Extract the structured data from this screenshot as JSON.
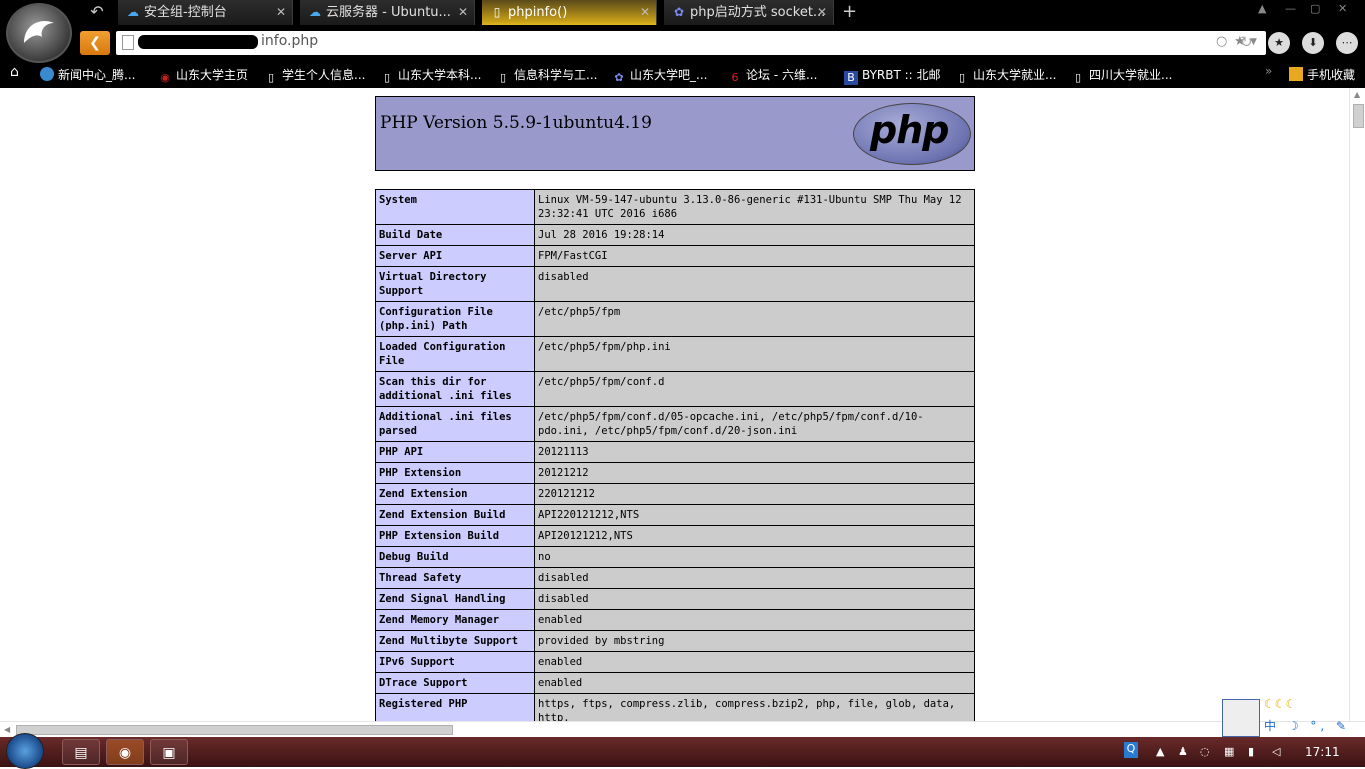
{
  "browser": {
    "tabs": [
      {
        "label": "安全组-控制台",
        "icon": "cloud-icon"
      },
      {
        "label": "云服务器 - Ubuntu...",
        "icon": "cloud-icon"
      },
      {
        "label": "phpinfo()",
        "icon": "page-icon"
      },
      {
        "label": "php启动方式 socket...",
        "icon": "paw-icon"
      }
    ],
    "new_tab": "+",
    "url": "info.php",
    "bookmarks": [
      {
        "label": "新闻中心_腾...",
        "icon": "chrome-icon"
      },
      {
        "label": "山东大学主页",
        "icon": "sdu-icon"
      },
      {
        "label": "学生个人信息...",
        "icon": "page-icon"
      },
      {
        "label": "山东大学本科...",
        "icon": "page-icon"
      },
      {
        "label": "信息科学与工...",
        "icon": "page-icon"
      },
      {
        "label": "山东大学吧_...",
        "icon": "paw-icon"
      },
      {
        "label": "论坛 - 六维...",
        "icon": "six-icon"
      },
      {
        "label": "BYRBT :: 北邮",
        "icon": "byr-icon"
      },
      {
        "label": "山东大学就业...",
        "icon": "page-icon"
      },
      {
        "label": "四川大学就业...",
        "icon": "page-icon"
      }
    ],
    "bookmark_more": "»",
    "mobile_favorites": "手机收藏"
  },
  "php": {
    "version_title": "PHP Version 5.5.9-1ubuntu4.19",
    "logo_text": "php",
    "rows": [
      [
        "System",
        "Linux VM-59-147-ubuntu 3.13.0-86-generic #131-Ubuntu SMP Thu May 12 23:32:41 UTC 2016 i686"
      ],
      [
        "Build Date",
        "Jul 28 2016 19:28:14"
      ],
      [
        "Server API",
        "FPM/FastCGI"
      ],
      [
        "Virtual Directory Support",
        "disabled"
      ],
      [
        "Configuration File (php.ini) Path",
        "/etc/php5/fpm"
      ],
      [
        "Loaded Configuration File",
        "/etc/php5/fpm/php.ini"
      ],
      [
        "Scan this dir for additional .ini files",
        "/etc/php5/fpm/conf.d"
      ],
      [
        "Additional .ini files parsed",
        "/etc/php5/fpm/conf.d/05-opcache.ini, /etc/php5/fpm/conf.d/10-pdo.ini, /etc/php5/fpm/conf.d/20-json.ini"
      ],
      [
        "PHP API",
        "20121113"
      ],
      [
        "PHP Extension",
        "20121212"
      ],
      [
        "Zend Extension",
        "220121212"
      ],
      [
        "Zend Extension Build",
        "API220121212,NTS"
      ],
      [
        "PHP Extension Build",
        "API20121212,NTS"
      ],
      [
        "Debug Build",
        "no"
      ],
      [
        "Thread Safety",
        "disabled"
      ],
      [
        "Zend Signal Handling",
        "disabled"
      ],
      [
        "Zend Memory Manager",
        "enabled"
      ],
      [
        "Zend Multibyte Support",
        "provided by mbstring"
      ],
      [
        "IPv6 Support",
        "enabled"
      ],
      [
        "DTrace Support",
        "enabled"
      ],
      [
        "Registered PHP",
        "https, ftps, compress.zlib, compress.bzip2, php, file, glob, data, http,"
      ]
    ]
  },
  "ime": {
    "moons": "☾☾☾",
    "tools": "中 ☽ °, ✎ ▤"
  },
  "taskbar": {
    "clock": "17:11"
  }
}
